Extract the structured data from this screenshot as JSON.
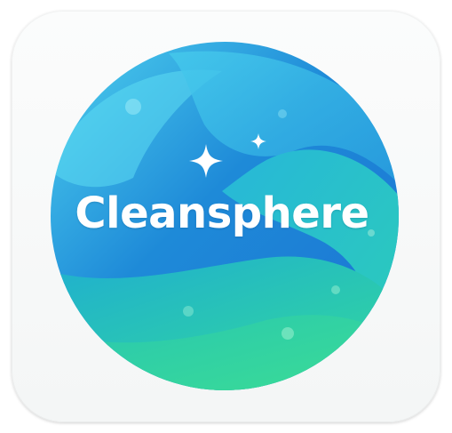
{
  "app_icon": {
    "name": "Cleansphere",
    "icons": [
      "sparkle-icon-large",
      "sparkle-icon-small"
    ],
    "colors": {
      "tile_background": "#f5f7f7",
      "sphere_top_left": "#4fd3ee",
      "sphere_mid": "#1a8fd6",
      "sphere_bottom": "#2ed89a",
      "wordmark": "#ffffff"
    }
  }
}
